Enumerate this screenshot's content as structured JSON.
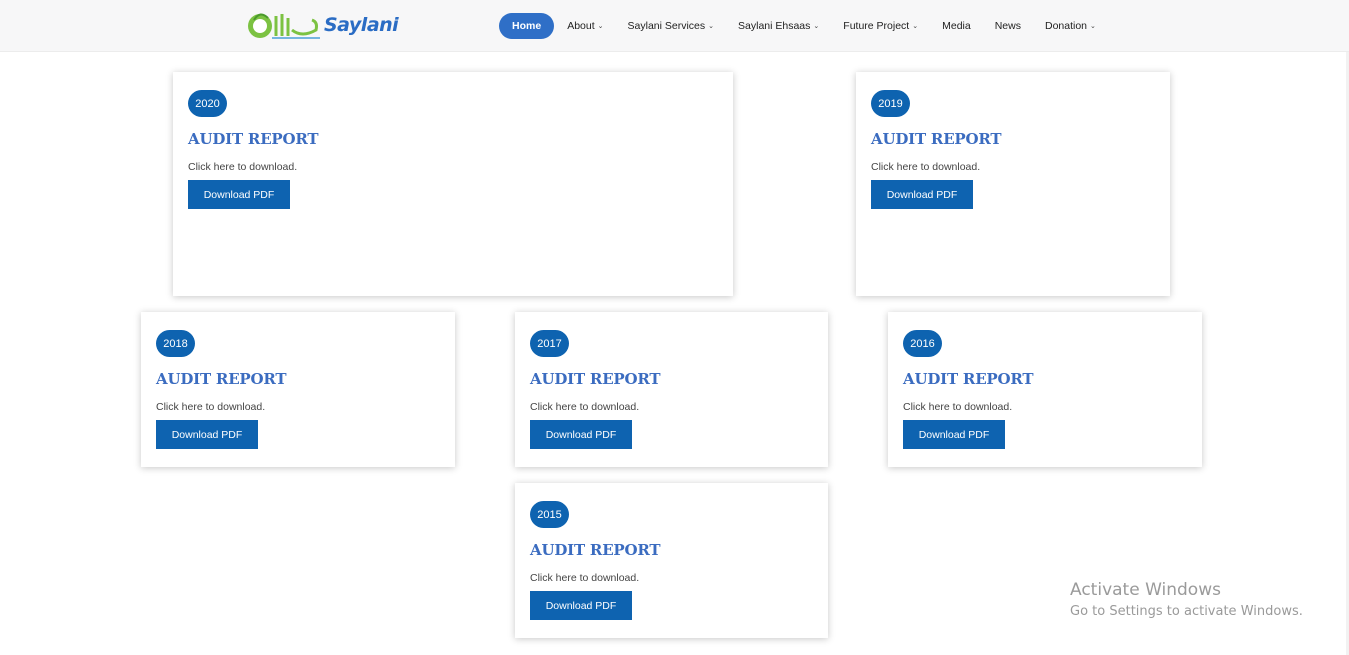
{
  "header": {
    "logo_text": "Saylani",
    "logo_urdu": "سیلانی",
    "nav": [
      {
        "label": "Home",
        "active": true,
        "dropdown": false
      },
      {
        "label": "About",
        "active": false,
        "dropdown": true
      },
      {
        "label": "Saylani Services",
        "active": false,
        "dropdown": true
      },
      {
        "label": "Saylani Ehsaas",
        "active": false,
        "dropdown": true
      },
      {
        "label": "Future Project",
        "active": false,
        "dropdown": true
      },
      {
        "label": "Media",
        "active": false,
        "dropdown": false
      },
      {
        "label": "News",
        "active": false,
        "dropdown": false
      },
      {
        "label": "Donation",
        "active": false,
        "dropdown": true
      }
    ]
  },
  "reports": [
    {
      "year": "2020",
      "title": "AUDIT REPORT",
      "text": "Click here to download.",
      "button": "Download PDF"
    },
    {
      "year": "2019",
      "title": "AUDIT REPORT",
      "text": "Click here to download.",
      "button": "Download PDF"
    },
    {
      "year": "2018",
      "title": "AUDIT REPORT",
      "text": "Click here to download.",
      "button": "Download PDF"
    },
    {
      "year": "2017",
      "title": "AUDIT REPORT",
      "text": "Click here to download.",
      "button": "Download PDF"
    },
    {
      "year": "2016",
      "title": "AUDIT REPORT",
      "text": "Click here to download.",
      "button": "Download PDF"
    },
    {
      "year": "2015",
      "title": "AUDIT REPORT",
      "text": "Click here to download.",
      "button": "Download PDF"
    }
  ],
  "watermark": {
    "title": "Activate Windows",
    "subtitle": "Go to Settings to activate Windows."
  },
  "colors": {
    "accent": "#0e63b0",
    "nav_active": "#2f6fc7",
    "title": "#3b6cc0",
    "logo_green": "#7cc242"
  }
}
